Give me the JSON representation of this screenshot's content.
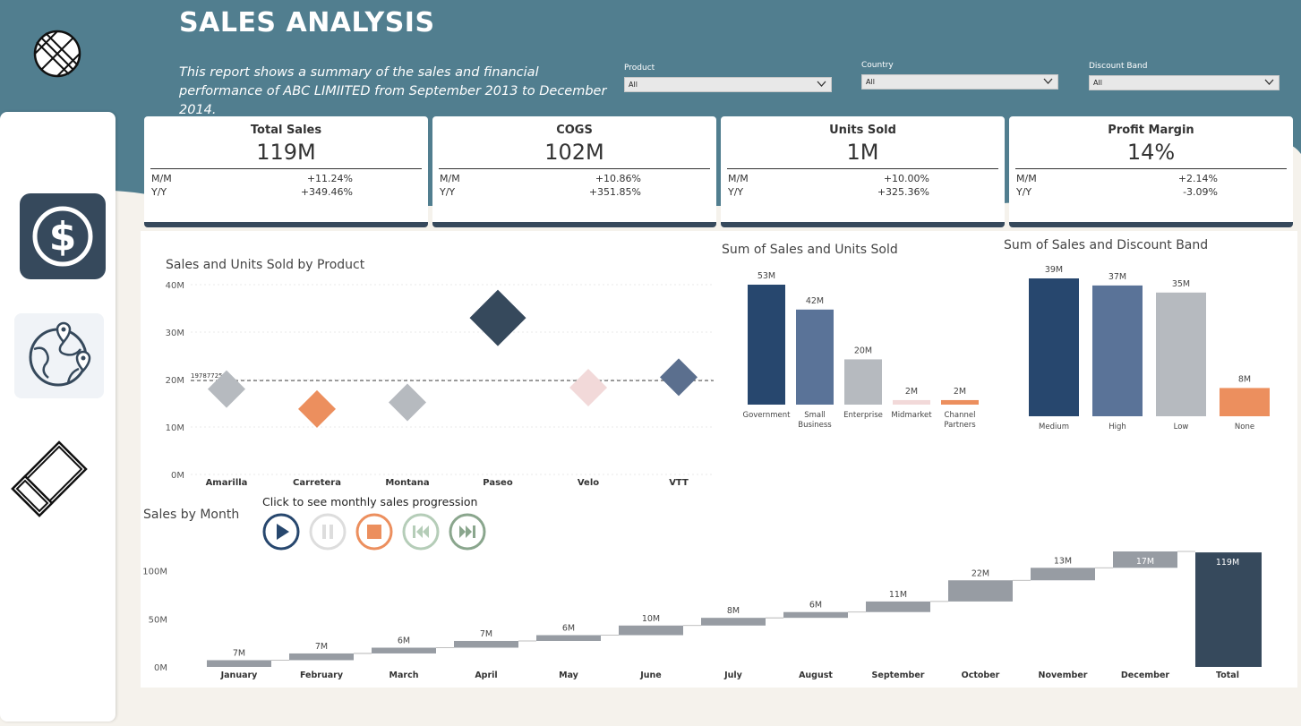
{
  "header": {
    "title": "SALES ANALYSIS",
    "subtitle": "This report shows a summary of the sales and financial performance of ABC LIMIITED from September 2013 to December 2014."
  },
  "filters": [
    {
      "label": "Product",
      "value": "All"
    },
    {
      "label": "Country",
      "value": "All"
    },
    {
      "label": "Discount Band",
      "value": "All"
    }
  ],
  "sidebar": {
    "items": [
      {
        "name": "sales",
        "icon": "dollar-icon",
        "active": true
      },
      {
        "name": "geography",
        "icon": "globe-icon",
        "active": false
      },
      {
        "name": "clear",
        "icon": "eraser-icon",
        "active": false
      }
    ]
  },
  "kpis": [
    {
      "title": "Total Sales",
      "value": "119M",
      "mm_label": "M/M",
      "mm": "+11.24%",
      "yy_label": "Y/Y",
      "yy": "+349.46%"
    },
    {
      "title": "COGS",
      "value": "102M",
      "mm_label": "M/M",
      "mm": "+10.86%",
      "yy_label": "Y/Y",
      "yy": "+351.85%"
    },
    {
      "title": "Units Sold",
      "value": "1M",
      "mm_label": "M/M",
      "mm": "+10.00%",
      "yy_label": "Y/Y",
      "yy": "+325.36%"
    },
    {
      "title": "Profit Margin",
      "value": "14%",
      "mm_label": "M/M",
      "mm": "+2.14%",
      "yy_label": "Y/Y",
      "yy": "-3.09%"
    }
  ],
  "colors": {
    "header": "#517e8f",
    "dark": "#36495c",
    "navy": "#27476e",
    "slate": "#5a7398",
    "gray": "#b6babf",
    "pink": "#f2d9d9",
    "orange": "#ec8f5e",
    "steel": "#5b6f8e",
    "waterfall": "#979ca3",
    "total": "#36495c",
    "pause": "#dddddd",
    "prev": "#b5cdb8",
    "next": "#8aa68d"
  },
  "player": {
    "caption": "Click to see monthly sales progression",
    "buttons": [
      "play-icon",
      "pause-icon",
      "stop-icon",
      "skip-back-icon",
      "skip-forward-icon"
    ]
  },
  "chart_data": [
    {
      "type": "scatter",
      "title": "Sales and Units Sold by Product",
      "categories": [
        "Amarilla",
        "Carretera",
        "Montana",
        "Paseo",
        "Velo",
        "VTT"
      ],
      "values": [
        18,
        13.8,
        15.2,
        33,
        18.3,
        20.5
      ],
      "sizes": [
        1,
        1,
        1,
        1.5,
        1,
        1
      ],
      "colors": [
        "#b6babf",
        "#ec8f5e",
        "#b6babf",
        "#36495c",
        "#f2d9d9",
        "#5b6f8e"
      ],
      "yticks": [
        "0M",
        "10M",
        "20M",
        "30M",
        "40M"
      ],
      "ylim": [
        0,
        40
      ],
      "reference_line": {
        "value": 19.787725,
        "label": "19787725"
      },
      "grid": true
    },
    {
      "type": "bar",
      "title": "Sum of Sales and Units Sold",
      "categories": [
        "Government",
        "Small Business",
        "Enterprise",
        "Midmarket",
        "Channel Partners"
      ],
      "values": [
        53,
        42,
        20,
        2,
        2
      ],
      "labels": [
        "53M",
        "42M",
        "20M",
        "2M",
        "2M"
      ],
      "colors": [
        "#27476e",
        "#5a7398",
        "#b6babf",
        "#f2d9d9",
        "#ec8f5e"
      ]
    },
    {
      "type": "bar",
      "title": "Sum of Sales and Discount Band",
      "categories": [
        "Medium",
        "High",
        "Low",
        "None"
      ],
      "values": [
        39,
        37,
        35,
        8
      ],
      "labels": [
        "39M",
        "37M",
        "35M",
        "8M"
      ],
      "colors": [
        "#27476e",
        "#5a7398",
        "#b6babf",
        "#ec8f5e"
      ]
    },
    {
      "type": "bar",
      "subtype": "waterfall",
      "title": "Sales by Month",
      "categories": [
        "January",
        "February",
        "March",
        "April",
        "May",
        "June",
        "July",
        "August",
        "September",
        "October",
        "November",
        "December",
        "Total"
      ],
      "values": [
        7,
        7,
        6,
        7,
        6,
        10,
        8,
        6,
        11,
        22,
        13,
        17,
        119
      ],
      "labels": [
        "7M",
        "7M",
        "6M",
        "7M",
        "6M",
        "10M",
        "8M",
        "6M",
        "11M",
        "22M",
        "13M",
        "17M",
        "119M"
      ],
      "yticks": [
        "0M",
        "50M",
        "100M"
      ],
      "ylim": [
        0,
        120
      ]
    }
  ]
}
